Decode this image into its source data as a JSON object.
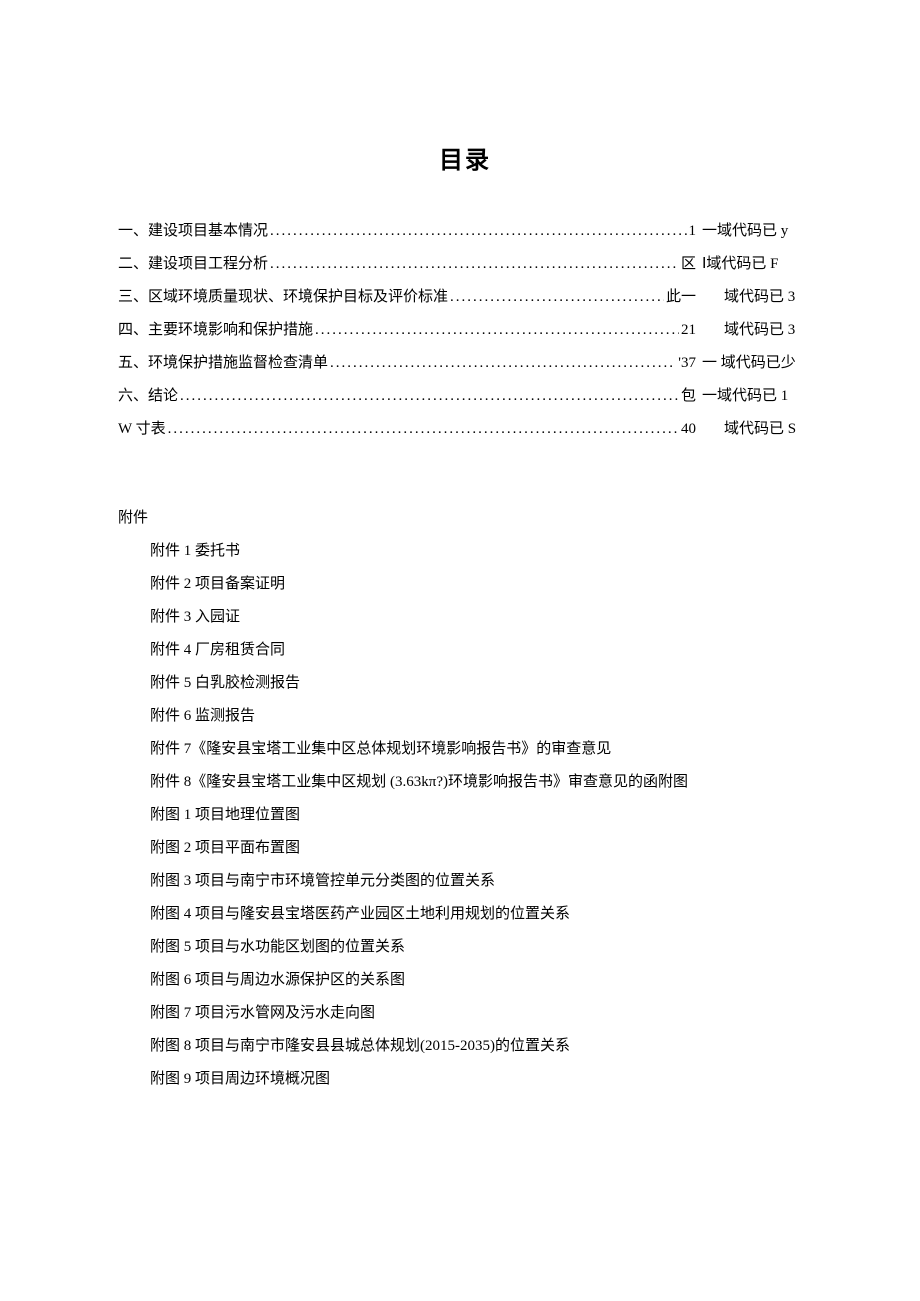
{
  "title": "目录",
  "toc": [
    {
      "label": "一、建设项目基本情况",
      "page": "1",
      "note": "一域代码已 y",
      "noteIndent": false
    },
    {
      "label": "二、建设项目工程分析",
      "page": "区",
      "note": "Ⅰ域代码已 F",
      "noteIndent": false
    },
    {
      "label": "三、区域环境质量现状、环境保护目标及评价标准",
      "page": "此一",
      "note": "域代码已 3",
      "noteIndent": true
    },
    {
      "label": "四、主要环境影响和保护措施",
      "page": "21",
      "note": "域代码已 3",
      "noteIndent": true
    },
    {
      "label": "五、环境保护措施监督检查清单",
      "page": "'37",
      "note": "一 域代码已少",
      "noteIndent": false
    },
    {
      "label": "六、结论",
      "page": "包",
      "note": "一域代码已 1",
      "noteIndent": false
    },
    {
      "label": "W 寸表",
      "page": "40",
      "note": "域代码已 S",
      "noteIndent": true
    }
  ],
  "attachments_header": "附件",
  "attachments": [
    "附件 1 委托书",
    "附件 2 项目备案证明",
    "附件 3 入园证",
    "附件 4 厂房租赁合同",
    "附件 5 白乳胶检测报告",
    "附件 6 监测报告",
    "附件 7《隆安县宝塔工业集中区总体规划环境影响报告书》的审查意见",
    "附件 8《隆安县宝塔工业集中区规划 (3.63kπ?)环境影响报告书》审查意见的函附图",
    "附图 1 项目地理位置图",
    "附图 2 项目平面布置图",
    "附图 3 项目与南宁市环境管控单元分类图的位置关系",
    "附图 4 项目与隆安县宝塔医药产业园区土地利用规划的位置关系",
    "附图 5 项目与水功能区划图的位置关系",
    "附图 6 项目与周边水源保护区的关系图",
    "附图 7 项目污水管网及污水走向图",
    "附图 8 项目与南宁市隆安县县城总体规划(2015-2035)的位置关系",
    "附图 9 项目周边环境概况图"
  ]
}
